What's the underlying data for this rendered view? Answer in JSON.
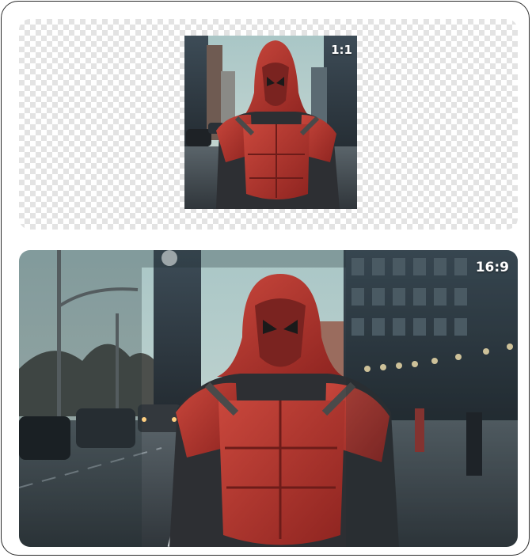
{
  "previews": [
    {
      "ratio_label": "1:1"
    },
    {
      "ratio_label": "16:9"
    }
  ],
  "colors": {
    "frame_border": "#2a2a2a",
    "suit_red": "#b8322b",
    "sky": "#b9d2d0"
  },
  "icons": {
    "transparency": "checkerboard-pattern"
  }
}
